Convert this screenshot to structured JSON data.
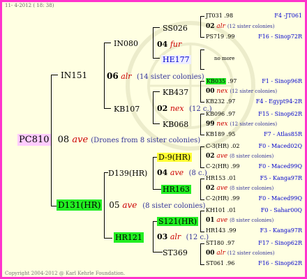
{
  "header_date": "11-  4-2012 ( 18: 38)",
  "footer": "Copyright 2004-2012 @ Karl Kehrle Foundation.",
  "colors": {
    "frame": "#ff33cc",
    "background": "#ffffe2",
    "highlight_pink": "#ffccff",
    "highlight_green": "#22ee22",
    "highlight_yellow": "#ffff33",
    "highlight_lavender": "#eeeeff",
    "name_red": "#cc0000",
    "blue": "#0000cc",
    "purple": "#333399"
  },
  "root": {
    "name": "PC810",
    "year": "08",
    "race": "ave",
    "note": "(Drones from 8 sister colonies)"
  },
  "gen1": [
    {
      "name": "IN151"
    },
    {
      "name": "D131(HR)",
      "year": "05",
      "race": "ave",
      "note": "(8 sister colonies)"
    }
  ],
  "gen2": [
    {
      "name": "IN080"
    },
    {
      "name": "KB107",
      "year": "06",
      "race": "alr",
      "note": "(14 sister colonies)"
    },
    {
      "name": "D139(HR)",
      "year": "04",
      "race": "ave",
      "note": "(8 c.)"
    },
    {
      "name": "HR121",
      "year": "03",
      "race": "alr",
      "note": "(12 c.)"
    }
  ],
  "gen3": [
    {
      "name": "SS026"
    },
    {
      "name": "HE177",
      "year": "04",
      "race": "fur"
    },
    {
      "name": "KB437"
    },
    {
      "name": "KB068",
      "year": "02",
      "race": "nex",
      "note": "(12 c.)"
    },
    {
      "name": "D-9(HR)",
      "year": "04",
      "race": "ave",
      "note": "(8 c.)"
    },
    {
      "name": "HR163"
    },
    {
      "name": "S121(HR)",
      "year": "01",
      "race": "ave",
      "note": "(8 sister colonies)"
    },
    {
      "name": "ST369",
      "year": "03",
      "race": "alr",
      "note": "(12 c.)"
    }
  ],
  "gen4": [
    {
      "name": "JT031",
      "year": ".98",
      "origin": "F4 -JT061"
    },
    {
      "name": "02",
      "race": "alr",
      "note": "(12 sister colonies)"
    },
    {
      "name": "PS719",
      "year": ".99",
      "origin": "F16 - Sinop72R"
    },
    {
      "name": "no more"
    },
    {
      "name": "KB035",
      "year": ".97",
      "origin": "F1 - Sinop96R"
    },
    {
      "name": "00",
      "race": "nex",
      "note": "(12 sister colonies)"
    },
    {
      "name": "KB232",
      "year": ".97",
      "origin": "F4 - Egypt94-2R"
    },
    {
      "name": "KB096",
      "year": ".97",
      "origin": "F15 - Sinop62R"
    },
    {
      "name": "99",
      "race": "nex",
      "note": "(12 sister colonies)"
    },
    {
      "name": "KB189",
      "year": ".95",
      "origin": "F7 - Atlas85R"
    },
    {
      "name": "C-3(HR)",
      "year": ".02",
      "origin": "F0 - Maced02Q"
    },
    {
      "name": "02",
      "race": "ave",
      "note": "(8 sister colonies)"
    },
    {
      "name": "C-2(HR)",
      "year": ".99",
      "origin": "F0 - Maced99Q"
    },
    {
      "name": "HR153",
      "year": ".01",
      "origin": "F5 - Kanga97R"
    },
    {
      "name": "02",
      "race": "ave",
      "note": "(8 sister colonies)"
    },
    {
      "name": "C-2(HR)",
      "year": ".99",
      "origin": "F0 - Maced99Q"
    },
    {
      "name": "KH101",
      "year": ".01",
      "origin": "F0 - Sahar00Q"
    },
    {
      "name": "01",
      "race": "ave",
      "note": "(8 sister colonies)"
    },
    {
      "name": "HR143",
      "year": ".99",
      "origin": "F3 - Kanga97R"
    },
    {
      "name": "ST180",
      "year": ".97",
      "origin": "F17 - Sinop62R"
    },
    {
      "name": "00",
      "race": "alr",
      "note": "(12 sister colonies)"
    },
    {
      "name": "ST061",
      "year": ".96",
      "origin": "F16 - Sinop62R"
    }
  ]
}
